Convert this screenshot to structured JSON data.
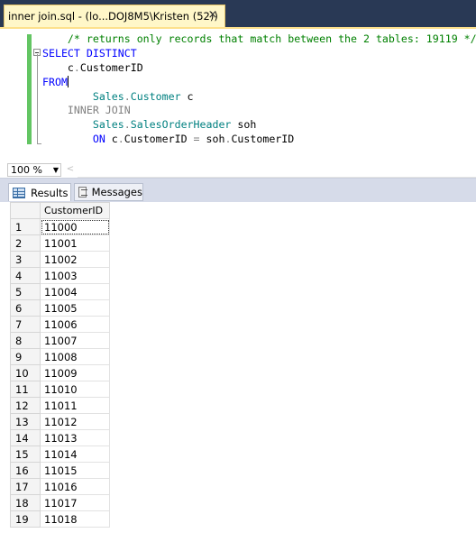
{
  "tab": {
    "title": "inner join.sql - (lo...DOJ8M5\\Kristen (52))",
    "close_glyph": "×"
  },
  "editor": {
    "lines": [
      {
        "tokens": [
          {
            "cls": "c",
            "text": "/* returns only records that match between the 2 tables: 19119 */"
          }
        ],
        "indent": "    "
      },
      {
        "tokens": [
          {
            "cls": "k",
            "text": "SELECT DISTINCT"
          }
        ],
        "indent": ""
      },
      {
        "tokens": [
          {
            "cls": "n",
            "text": "c"
          },
          {
            "cls": "g",
            "text": "."
          },
          {
            "cls": "n",
            "text": "CustomerID"
          }
        ],
        "indent": "    "
      },
      {
        "tokens": [
          {
            "cls": "k",
            "text": "FROM"
          }
        ],
        "indent": "",
        "cursor": true
      },
      {
        "tokens": [
          {
            "cls": "t",
            "text": "Sales"
          },
          {
            "cls": "g",
            "text": "."
          },
          {
            "cls": "t",
            "text": "Customer"
          },
          {
            "cls": "n",
            "text": " c"
          }
        ],
        "indent": "        "
      },
      {
        "tokens": [
          {
            "cls": "g",
            "text": "INNER JOIN"
          }
        ],
        "indent": "    "
      },
      {
        "tokens": [
          {
            "cls": "t",
            "text": "Sales"
          },
          {
            "cls": "g",
            "text": "."
          },
          {
            "cls": "t",
            "text": "SalesOrderHeader"
          },
          {
            "cls": "n",
            "text": " soh"
          }
        ],
        "indent": "        "
      },
      {
        "tokens": [
          {
            "cls": "k",
            "text": "ON"
          },
          {
            "cls": "n",
            "text": " c"
          },
          {
            "cls": "g",
            "text": "."
          },
          {
            "cls": "n",
            "text": "CustomerID "
          },
          {
            "cls": "g",
            "text": "="
          },
          {
            "cls": "n",
            "text": " soh"
          },
          {
            "cls": "g",
            "text": "."
          },
          {
            "cls": "n",
            "text": "CustomerID"
          }
        ],
        "indent": "        "
      }
    ]
  },
  "zoom": {
    "value": "100 %",
    "dropdown_glyph": "▼",
    "scroll_left_glyph": "<"
  },
  "results_tabs": {
    "results": "Results",
    "messages": "Messages"
  },
  "grid": {
    "column": "CustomerID",
    "rows": [
      {
        "n": "1",
        "v": "11000"
      },
      {
        "n": "2",
        "v": "11001"
      },
      {
        "n": "3",
        "v": "11002"
      },
      {
        "n": "4",
        "v": "11003"
      },
      {
        "n": "5",
        "v": "11004"
      },
      {
        "n": "6",
        "v": "11005"
      },
      {
        "n": "7",
        "v": "11006"
      },
      {
        "n": "8",
        "v": "11007"
      },
      {
        "n": "9",
        "v": "11008"
      },
      {
        "n": "10",
        "v": "11009"
      },
      {
        "n": "11",
        "v": "11010"
      },
      {
        "n": "12",
        "v": "11011"
      },
      {
        "n": "13",
        "v": "11012"
      },
      {
        "n": "14",
        "v": "11013"
      },
      {
        "n": "15",
        "v": "11014"
      },
      {
        "n": "16",
        "v": "11015"
      },
      {
        "n": "17",
        "v": "11016"
      },
      {
        "n": "18",
        "v": "11017"
      },
      {
        "n": "19",
        "v": "11018"
      }
    ]
  },
  "colors": {
    "tabstrip": "#293955",
    "active_tab": "#fff7c8",
    "keyword": "#0000ff",
    "comment": "#008000",
    "identifier_table": "#008080",
    "operator": "#808080",
    "change_bar": "#63c563"
  }
}
